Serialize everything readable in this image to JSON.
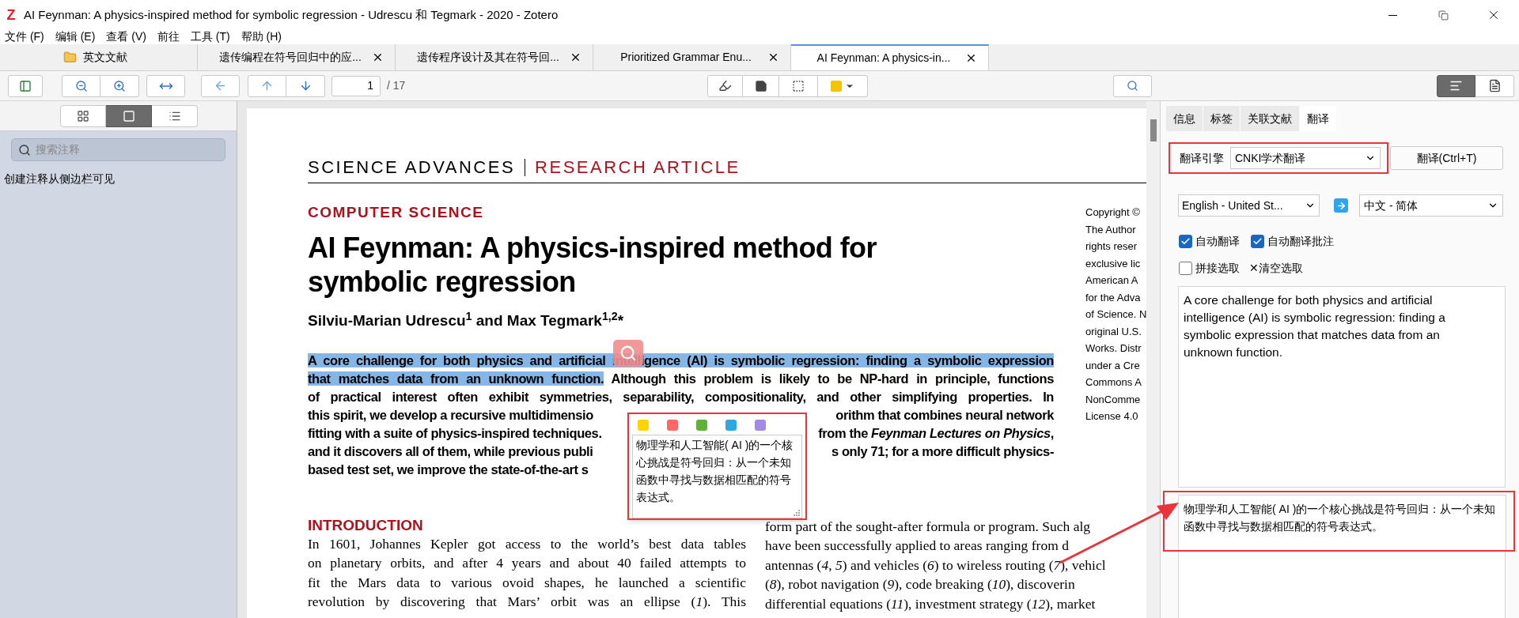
{
  "window": {
    "logo": "Z",
    "title": "AI Feynman: A physics-inspired method for symbolic regression - Udrescu 和 Tegmark - 2020 - Zotero"
  },
  "menu": [
    "文件 (F)",
    "编辑 (E)",
    "查看 (V)",
    "前往",
    "工具 (T)",
    "帮助 (H)"
  ],
  "tabs": [
    {
      "kind": "library",
      "label": "英文文献",
      "selected": false
    },
    {
      "kind": "reader",
      "label": "遗传编程在符号回归中的应...",
      "selected": false
    },
    {
      "kind": "reader",
      "label": "遗传程序设计及其在符号回...",
      "selected": false
    },
    {
      "kind": "reader",
      "label": "Prioritized Grammar Enu...",
      "selected": false
    },
    {
      "kind": "reader",
      "label": "AI Feynman: A physics-in...",
      "selected": true
    }
  ],
  "toolbar": {
    "page": "1",
    "page_total": "/ 17",
    "view_modes": [
      {
        "selected": true
      },
      {
        "selected": false
      }
    ]
  },
  "sidebar": {
    "views": [
      {
        "selected": false
      },
      {
        "selected": true
      },
      {
        "selected": false
      }
    ],
    "search": {
      "placeholder": "搜索注释"
    },
    "note": "创建注释从侧边栏可见"
  },
  "document": {
    "journal": "SCIENCE ADVANCES",
    "article_type": "RESEARCH ARTICLE",
    "section": "COMPUTER SCIENCE",
    "title_lines": [
      "AI Feynman: A physics-inspired method for",
      "symbolic regression"
    ],
    "authors": "Silviu-Marian Udrescu$^{1}$ and Max Tegmark$^{1,2}$*",
    "abstract_lines": [
      {
        "left": [
          {
            "text": "A core challenge for both physics and artificial intelligence (AI) is symbolic regression: finding a symbolic expression",
            "highlighted": true
          }
        ]
      },
      {
        "left": [
          {
            "text": "that matches data from an unknown function.",
            "highlighted": true
          },
          {
            "text": " Although this problem is likely to be NP-hard in principle, functions",
            "highlighted": false
          }
        ]
      },
      {
        "left": [
          {
            "text": "of practical interest often exhibit symmetries, separability, compositionality, and other simplifying properties. In",
            "highlighted": false
          }
        ]
      },
      {
        "left": [
          {
            "text": "this spirit, we develop a recursive multidimensio",
            "highlighted": false
          }
        ],
        "right": "orithm that combines neural network"
      },
      {
        "left": [
          {
            "text": "fitting with a suite of physics-inspired techniques.",
            "highlighted": false
          }
        ],
        "right": "from the *Feynman Lectures on Physics*,"
      },
      {
        "left": [
          {
            "text": "and it discovers all of them, while previous publi",
            "highlighted": false
          }
        ],
        "right": "s only 71; for a more difficult physics-"
      },
      {
        "left": [
          {
            "text": "based test set, we improve the state-of-the-art s",
            "highlighted": false
          }
        ]
      }
    ],
    "copyright_lines": [
      "Copyright ©",
      "The Author",
      "rights reser",
      "exclusive lic",
      "American A",
      "for the Adva",
      "of Science. N",
      "original U.S.",
      "Works. Distr",
      "under a Cre",
      "Commons A",
      "NonComme",
      "License 4.0"
    ],
    "intro": {
      "heading": "INTRODUCTION",
      "left_lines": [
        "In 1601, Johannes Kepler got access to the world’s best data tables",
        "on planetary orbits, and after 4 years and about 40 failed attempts to",
        "fit the Mars data to various ovoid shapes, he launched a scientific",
        "revolution by discovering that Mars’ orbit was an ellipse (*1*). This"
      ],
      "right_lines": [
        "form part of the sought-after formula or program. Such alg",
        "have been successfully applied to areas ranging from d",
        "antennas (*4*, *5*) and vehicles (*6*) to wireless routing (*7*), vehicl",
        "(*8*), robot navigation (*9*), code breaking (*10*), discoverin",
        "differential equations (*11*), investment strategy (*12*), market"
      ]
    }
  },
  "popup": {
    "colors": [
      {
        "color": "#ffd400"
      },
      {
        "color": "#ff6666"
      },
      {
        "color": "#5fb236"
      },
      {
        "color": "#2ea8e5"
      },
      {
        "color": "#a28ae5"
      }
    ],
    "translation": "物理学和人工智能( AI )的一个核心挑战是符号回归：从一个未知函数中寻找与数据相匹配的符号表达式。"
  },
  "translation_panel": {
    "tabs": [
      {
        "label": "信息",
        "selected": false
      },
      {
        "label": "标签",
        "selected": false
      },
      {
        "label": "关联文献",
        "selected": false
      },
      {
        "label": "翻译",
        "selected": true
      }
    ],
    "engine_label": "翻译引擎",
    "engine": "CNKI学术翻译",
    "translate_button": "翻译(Ctrl+T)",
    "source_lang": "English - United St...",
    "target_lang": "中文 - 简体",
    "options": [
      {
        "label": "自动翻译",
        "checked": true
      },
      {
        "label": "自动翻译批注",
        "checked": true
      }
    ],
    "concat": {
      "label": "拼接选取",
      "checked": false
    },
    "clear": "✕清空选取",
    "source_text": "A core challenge for both physics and artificial intelligence (AI) is symbolic regression: finding a symbolic expression that matches data from an unknown function.",
    "result_text": "物理学和人工智能( AI )的一个核心挑战是符号回归：从一个未知函数中寻找与数据相匹配的符号表达式。"
  }
}
